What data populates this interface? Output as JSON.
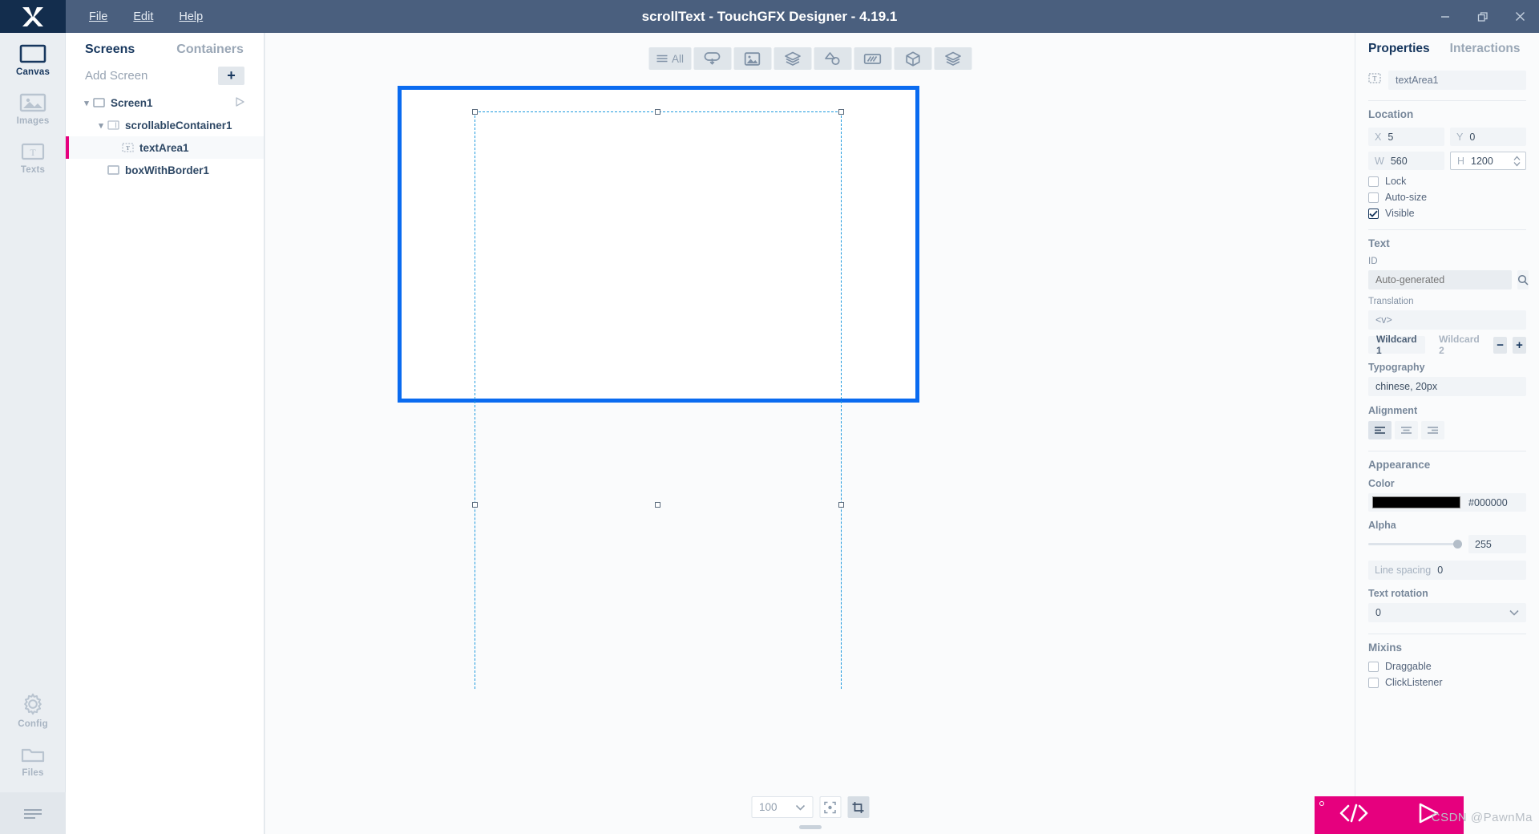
{
  "window": {
    "title": "scrollText - TouchGFX Designer - 4.19.1",
    "logo": "touchgfx-logo",
    "menu": [
      "File",
      "Edit",
      "Help"
    ],
    "controls": [
      "minimize-icon",
      "restore-icon",
      "close-icon"
    ]
  },
  "rail": {
    "items": [
      {
        "label": "Canvas",
        "icon": "canvas-icon",
        "active": true
      },
      {
        "label": "Images",
        "icon": "images-icon",
        "active": false
      },
      {
        "label": "Texts",
        "icon": "texts-icon",
        "active": false
      }
    ],
    "bottom": [
      {
        "label": "Config",
        "icon": "gear-icon"
      },
      {
        "label": "Files",
        "icon": "folder-icon"
      }
    ],
    "hamburger": "hamburger-icon"
  },
  "tree": {
    "tabs": [
      {
        "label": "Screens",
        "active": true
      },
      {
        "label": "Containers",
        "active": false
      }
    ],
    "add_screen_label": "Add Screen",
    "add_button": "+",
    "nodes": [
      {
        "label": "Screen1",
        "icon": "screen-icon",
        "depth": 0,
        "expanded": true,
        "selected": false,
        "has_run": true
      },
      {
        "label": "scrollableContainer1",
        "icon": "scrollable-container-icon",
        "depth": 1,
        "expanded": true,
        "selected": false,
        "has_run": false
      },
      {
        "label": "textArea1",
        "icon": "text-area-icon",
        "depth": 2,
        "expanded": false,
        "selected": true,
        "has_run": false
      },
      {
        "label": "boxWithBorder1",
        "icon": "box-with-border-icon",
        "depth": 1,
        "expanded": false,
        "selected": false,
        "has_run": false
      }
    ]
  },
  "canvas": {
    "toolbar": [
      {
        "name": "filter-all-button",
        "icon": "list-icon",
        "label": "All"
      },
      {
        "name": "widgets-button",
        "icon": "widget-icon",
        "label": ""
      },
      {
        "name": "images-button",
        "icon": "image-icon",
        "label": ""
      },
      {
        "name": "containers-button",
        "icon": "layers-icon",
        "label": ""
      },
      {
        "name": "shapes-button",
        "icon": "shapes-icon",
        "label": ""
      },
      {
        "name": "gauges-button",
        "icon": "gauge-icon",
        "label": ""
      },
      {
        "name": "3d-button",
        "icon": "cube-icon",
        "label": ""
      },
      {
        "name": "custom-button",
        "icon": "stack-icon",
        "label": ""
      }
    ],
    "zoom_value": "100",
    "fit_button": "fit-to-screen-icon",
    "crop_button": "crop-icon",
    "crop_active": true,
    "device_border_color": "#0a6bf0",
    "guide_color": "#1e9ade"
  },
  "properties": {
    "tabs": [
      {
        "label": "Properties",
        "active": true
      },
      {
        "label": "Interactions",
        "active": false
      }
    ],
    "widget_icon": "text-area-icon",
    "widget_name": "textArea1",
    "location": {
      "title": "Location",
      "x_label": "X",
      "x_value": "5",
      "y_label": "Y",
      "y_value": "0",
      "w_label": "W",
      "w_value": "560",
      "h_label": "H",
      "h_value": "1200",
      "checkboxes": [
        {
          "label": "Lock",
          "checked": false
        },
        {
          "label": "Auto-size",
          "checked": false
        },
        {
          "label": "Visible",
          "checked": true
        }
      ]
    },
    "text": {
      "title": "Text",
      "id_label": "ID",
      "id_placeholder": "Auto-generated",
      "search_icon": "search-icon",
      "translation_label": "Translation",
      "translation_value": "<v>",
      "wildcard1": "Wildcard 1",
      "wildcard2": "Wildcard 2",
      "minus": "−",
      "plus": "+",
      "typography_label": "Typography",
      "typography_value": "chinese, 20px",
      "alignment_label": "Alignment",
      "alignment_options": [
        "align-left-icon",
        "align-center-icon",
        "align-right-icon"
      ],
      "alignment_selected": 0
    },
    "appearance": {
      "title": "Appearance",
      "color_label": "Color",
      "color_value": "#000000",
      "alpha_label": "Alpha",
      "alpha_value": "255",
      "line_spacing_label": "Line spacing",
      "line_spacing_value": "0",
      "text_rotation_label": "Text rotation",
      "text_rotation_value": "0"
    },
    "mixins": {
      "title": "Mixins",
      "items": [
        {
          "label": "Draggable",
          "checked": false
        },
        {
          "label": "ClickListener",
          "checked": false
        }
      ]
    }
  },
  "actions": {
    "code_button": "code-icon",
    "run_button": "play-icon",
    "accent": "#e6007e"
  },
  "watermark": "CSDN @PawnMa"
}
